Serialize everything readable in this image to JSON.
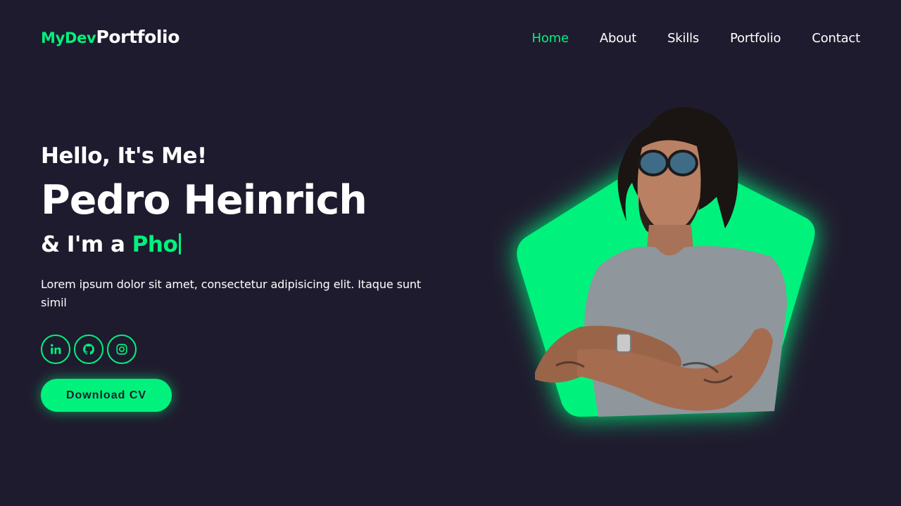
{
  "header": {
    "logo_accent": "MyDev",
    "logo_main": "Portfolio",
    "nav": [
      {
        "label": "Home",
        "active": true
      },
      {
        "label": "About",
        "active": false
      },
      {
        "label": "Skills",
        "active": false
      },
      {
        "label": "Portfolio",
        "active": false
      },
      {
        "label": "Contact",
        "active": false
      }
    ]
  },
  "hero": {
    "greeting": "Hello, It's Me!",
    "name": "Pedro Heinrich",
    "role_prefix": "& I'm a ",
    "role_typed": "Pho",
    "description": "Lorem ipsum dolor sit amet, consectetur adipisicing elit. Itaque sunt simil",
    "socials": [
      {
        "icon": "linkedin-icon"
      },
      {
        "icon": "github-icon"
      },
      {
        "icon": "instagram-icon"
      }
    ],
    "cta_label": "Download CV"
  },
  "colors": {
    "background": "#1f1b2e",
    "accent": "#00f27c",
    "text": "#ffffff"
  }
}
